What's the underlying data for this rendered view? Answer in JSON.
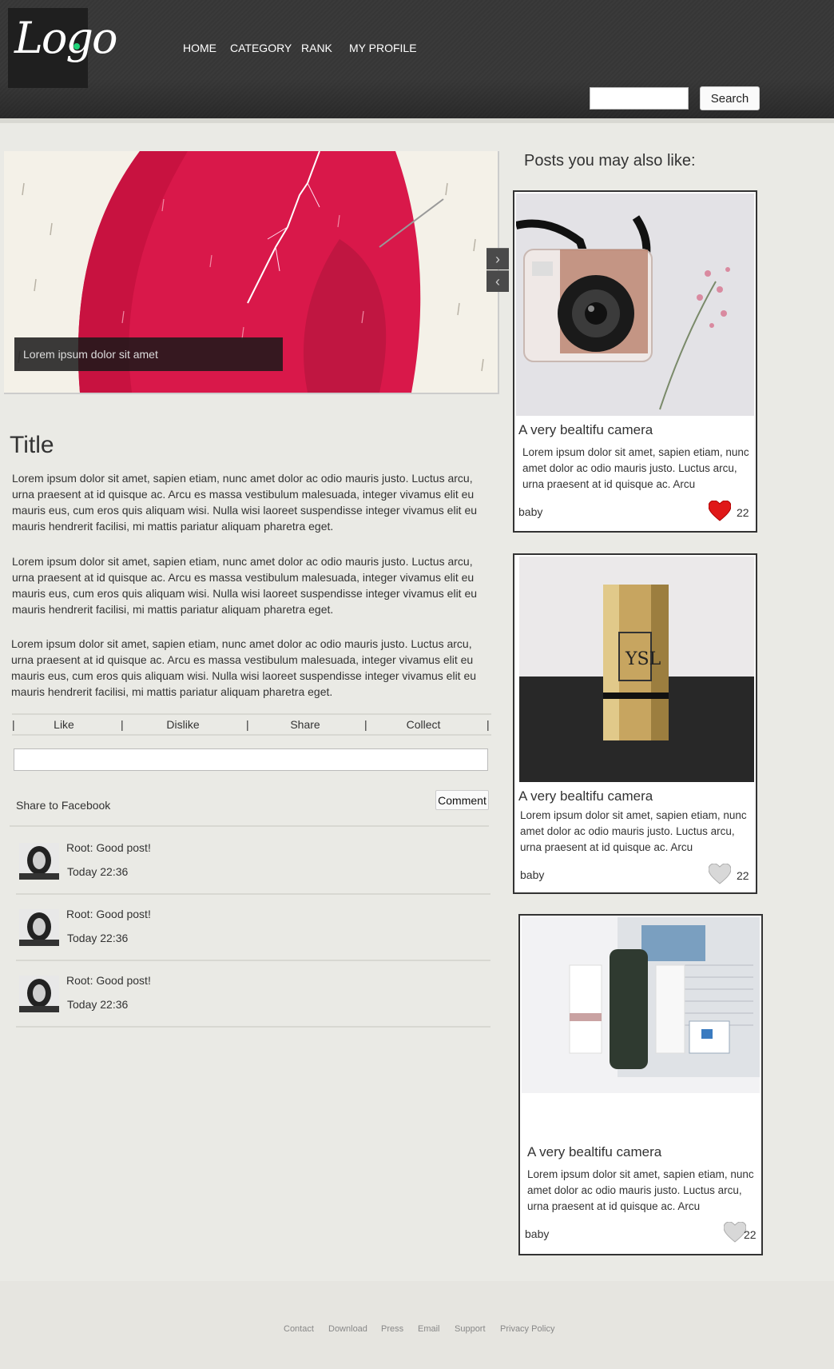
{
  "header": {
    "logo_text": "Logo",
    "nav": [
      "HOME",
      "CATEGORY",
      "RANK",
      "MY PROFILE"
    ],
    "search": {
      "value": "",
      "button_label": "Search"
    }
  },
  "slider": {
    "caption": "Lorem ipsum dolor sit amet",
    "next_icon": "chevron-right-icon",
    "prev_icon": "chevron-left-icon"
  },
  "article": {
    "title": "Title",
    "paragraphs": [
      "Lorem ipsum dolor sit amet, sapien etiam, nunc amet dolor ac odio mauris justo. Luctus arcu, urna praesent at id quisque ac. Arcu es massa vestibulum malesuada, integer vivamus elit eu mauris eus, cum eros quis aliquam wisi. Nulla wisi laoreet suspendisse integer vivamus elit eu mauris hendrerit facilisi, mi mattis pariatur aliquam pharetra eget.",
      "Lorem ipsum dolor sit amet, sapien etiam, nunc amet dolor ac odio mauris justo. Luctus arcu, urna praesent at id quisque ac. Arcu es massa vestibulum malesuada, integer vivamus elit eu mauris eus, cum eros quis aliquam wisi. Nulla wisi laoreet suspendisse integer vivamus elit eu mauris hendrerit facilisi, mi mattis pariatur aliquam pharetra eget.",
      "Lorem ipsum dolor sit amet, sapien etiam, nunc amet dolor ac odio mauris justo. Luctus arcu, urna praesent at id quisque ac. Arcu es massa vestibulum malesuada, integer vivamus elit eu mauris eus, cum eros quis aliquam wisi. Nulla wisi laoreet suspendisse integer vivamus elit eu mauris hendrerit facilisi, mi mattis pariatur aliquam pharetra eget."
    ],
    "actions": [
      "Like",
      "Dislike",
      "Share",
      "Collect"
    ],
    "separator": "|",
    "comment_input_value": "",
    "share_facebook": "Share to Facebook",
    "comment_button": "Comment",
    "comments": [
      {
        "text": "Root: Good post!",
        "time": "Today 22:36"
      },
      {
        "text": "Root: Good post!",
        "time": "Today 22:36"
      },
      {
        "text": "Root: Good post!",
        "time": "Today 22:36"
      }
    ]
  },
  "sidebar": {
    "title": "Posts you may also like:",
    "cards": [
      {
        "title": "A very bealtifu camera",
        "desc": "Lorem ipsum dolor sit amet, sapien etiam, nunc amet dolor ac odio mauris justo. Luctus arcu, urna praesent at id quisque ac. Arcu",
        "tag": "baby",
        "count": "22",
        "liked": true
      },
      {
        "title": "A very bealtifu camera",
        "desc": "Lorem ipsum dolor sit amet, sapien etiam, nunc amet dolor ac odio mauris justo. Luctus arcu, urna praesent at id quisque ac. Arcu",
        "tag": "baby",
        "count": "22",
        "liked": false
      },
      {
        "title": "A very bealtifu camera",
        "desc": "Lorem ipsum dolor sit amet, sapien etiam, nunc amet dolor ac odio mauris justo. Luctus arcu, urna praesent at id quisque ac. Arcu",
        "tag": "baby",
        "count": "22",
        "liked": false
      }
    ]
  },
  "footer": {
    "links": [
      "Contact",
      "Download",
      "Press",
      "Email",
      "Support",
      "Privacy Policy"
    ]
  },
  "colors": {
    "header_bg": "#3a3a3a",
    "page_bg": "#eaeae5",
    "heart_liked": "#e01818",
    "heart_unliked": "#d8d8d8",
    "slider_red": "#d9184a"
  }
}
